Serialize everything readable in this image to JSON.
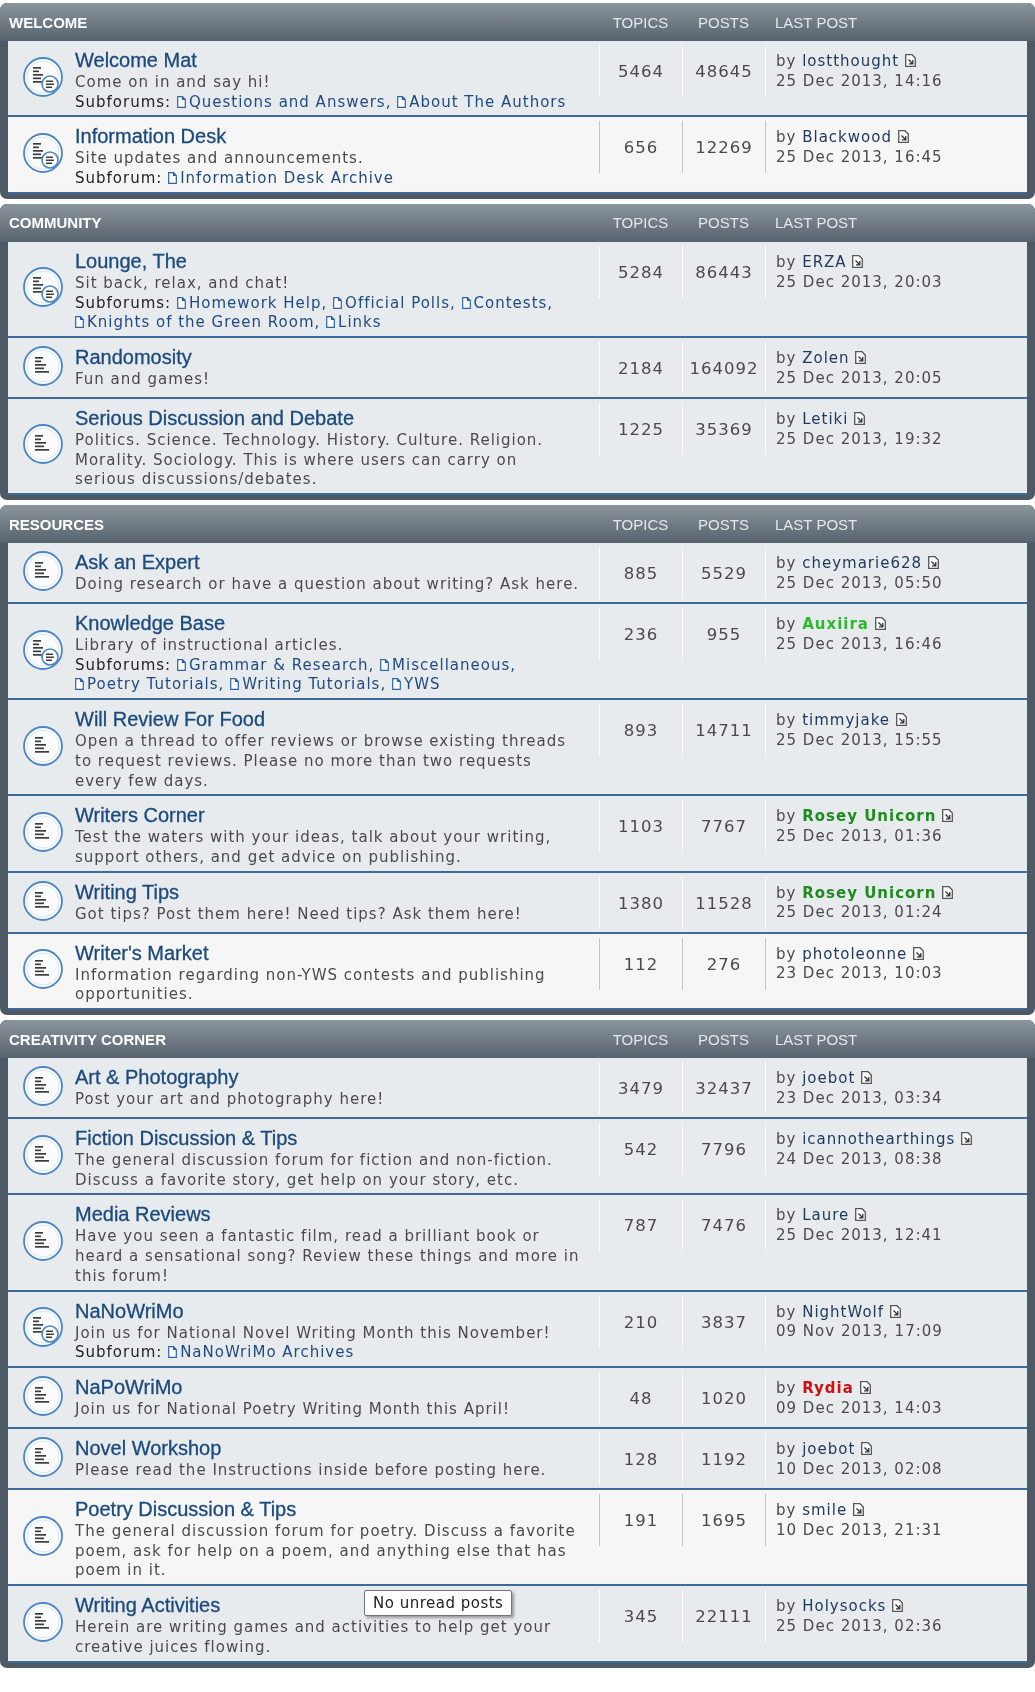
{
  "categories": [
    {
      "title": "WELCOME",
      "columns": [
        "TOPICS",
        "POSTS",
        "LAST POST"
      ],
      "forums": [
        {
          "title": "Welcome Mat",
          "description": "Come on in and say hi!",
          "subforums": {
            "label": "Subforums:",
            "items": [
              "Questions and Answers,",
              "About The Authors"
            ]
          },
          "topics": "5464",
          "posts": "48645",
          "last_post": {
            "by": "by",
            "author": {
              "name": "lostthought",
              "color": "#213a5c",
              "bold": false
            },
            "date": "25 Dec 2013, 14:16"
          },
          "highlighted": false
        },
        {
          "title": "Information Desk",
          "description": "Site updates and announcements.",
          "subforums": {
            "label": "Subforum:",
            "items": [
              "Information Desk Archive"
            ]
          },
          "topics": "656",
          "posts": "12269",
          "last_post": {
            "by": "by",
            "author": {
              "name": "Blackwood",
              "color": "#213a5c",
              "bold": false
            },
            "date": "25 Dec 2013, 16:45"
          },
          "highlighted": true
        }
      ]
    },
    {
      "title": "COMMUNITY",
      "columns": [
        "TOPICS",
        "POSTS",
        "LAST POST"
      ],
      "forums": [
        {
          "title": "Lounge, The",
          "description": "Sit back, relax, and chat!",
          "subforums": {
            "label": "Subforums:",
            "items": [
              "Homework Help,",
              "Official Polls,",
              "Contests,",
              "Knights of the Green Room,",
              "Links"
            ]
          },
          "topics": "5284",
          "posts": "86443",
          "last_post": {
            "by": "by",
            "author": {
              "name": "ERZA",
              "color": "#213a5c",
              "bold": false
            },
            "date": "25 Dec 2013, 20:03"
          },
          "highlighted": false
        },
        {
          "title": "Randomosity",
          "description": "Fun and games!",
          "topics": "2184",
          "posts": "164092",
          "last_post": {
            "by": "by",
            "author": {
              "name": "Zolen",
              "color": "#213a5c",
              "bold": false
            },
            "date": "25 Dec 2013, 20:05"
          },
          "highlighted": false
        },
        {
          "title": "Serious Discussion and Debate",
          "description": "Politics. Science. Technology. History. Culture. Religion. Morality. Sociology. This is where users can carry on serious discussions/debates.",
          "topics": "1225",
          "posts": "35369",
          "last_post": {
            "by": "by",
            "author": {
              "name": "Letiki",
              "color": "#213a5c",
              "bold": false
            },
            "date": "25 Dec 2013, 19:32"
          },
          "highlighted": false
        }
      ]
    },
    {
      "title": "RESOURCES",
      "columns": [
        "TOPICS",
        "POSTS",
        "LAST POST"
      ],
      "forums": [
        {
          "title": "Ask an Expert",
          "description": "Doing research or have a question about writing? Ask here.",
          "topics": "885",
          "posts": "5529",
          "last_post": {
            "by": "by",
            "author": {
              "name": "cheymarie628",
              "color": "#213a5c",
              "bold": false
            },
            "date": "25 Dec 2013, 05:50"
          },
          "highlighted": false
        },
        {
          "title": "Knowledge Base",
          "description": "Library of instructional articles.",
          "subforums": {
            "label": "Subforums:",
            "items": [
              "Grammar & Research,",
              "Miscellaneous,",
              "Poetry Tutorials,",
              "Writing Tutorials,",
              "YWS"
            ]
          },
          "topics": "236",
          "posts": "955",
          "last_post": {
            "by": "by",
            "author": {
              "name": "Auxiira",
              "color": "#2db82d",
              "bold": true
            },
            "date": "25 Dec 2013, 16:46"
          },
          "highlighted": false
        },
        {
          "title": "Will Review For Food",
          "description": "Open a thread to offer reviews or browse existing threads to request reviews. Please no more than two requests every few days.",
          "topics": "893",
          "posts": "14711",
          "last_post": {
            "by": "by",
            "author": {
              "name": "timmyjake",
              "color": "#213a5c",
              "bold": false
            },
            "date": "25 Dec 2013, 15:55"
          },
          "highlighted": false
        },
        {
          "title": "Writers Corner",
          "description": "Test the waters with your ideas, talk about your writing, support others, and get advice on publishing.",
          "topics": "1103",
          "posts": "7767",
          "last_post": {
            "by": "by",
            "author": {
              "name": "Rosey Unicorn",
              "color": "#1e8c1e",
              "bold": true
            },
            "date": "25 Dec 2013, 01:36"
          },
          "highlighted": false
        },
        {
          "title": "Writing Tips",
          "description": "Got tips? Post them here! Need tips? Ask them here!",
          "topics": "1380",
          "posts": "11528",
          "last_post": {
            "by": "by",
            "author": {
              "name": "Rosey Unicorn",
              "color": "#1e8c1e",
              "bold": true
            },
            "date": "25 Dec 2013, 01:24"
          },
          "highlighted": false
        },
        {
          "title": "Writer's Market",
          "description": "Information regarding non-YWS contests and publishing opportunities.",
          "topics": "112",
          "posts": "276",
          "last_post": {
            "by": "by",
            "author": {
              "name": "photoleonne",
              "color": "#213a5c",
              "bold": false
            },
            "date": "23 Dec 2013, 10:03"
          },
          "highlighted": true
        }
      ]
    },
    {
      "title": "CREATIVITY CORNER",
      "columns": [
        "TOPICS",
        "POSTS",
        "LAST POST"
      ],
      "forums": [
        {
          "title": "Art & Photography",
          "description": "Post your art and photography here!",
          "topics": "3479",
          "posts": "32437",
          "last_post": {
            "by": "by",
            "author": {
              "name": "joebot",
              "color": "#213a5c",
              "bold": false
            },
            "date": "23 Dec 2013, 03:34"
          },
          "highlighted": false
        },
        {
          "title": "Fiction Discussion & Tips",
          "description": "The general discussion forum for fiction and non-fiction. Discuss a favorite story, get help on your story, etc.",
          "topics": "542",
          "posts": "7796",
          "last_post": {
            "by": "by",
            "author": {
              "name": "icannothearthings",
              "color": "#213a5c",
              "bold": false
            },
            "date": "24 Dec 2013, 08:38"
          },
          "highlighted": false
        },
        {
          "title": "Media Reviews",
          "description": "Have you seen a fantastic film, read a brilliant book or heard a sensational song? Review these things and more in this forum!",
          "topics": "787",
          "posts": "7476",
          "last_post": {
            "by": "by",
            "author": {
              "name": "Laure",
              "color": "#213a5c",
              "bold": false
            },
            "date": "25 Dec 2013, 12:41"
          },
          "highlighted": false
        },
        {
          "title": "NaNoWriMo",
          "description": "Join us for National Novel Writing Month this November!",
          "subforums": {
            "label": "Subforum:",
            "items": [
              "NaNoWriMo Archives"
            ]
          },
          "topics": "210",
          "posts": "3837",
          "last_post": {
            "by": "by",
            "author": {
              "name": "NightWolf",
              "color": "#213a5c",
              "bold": false
            },
            "date": "09 Nov 2013, 17:09"
          },
          "highlighted": false
        },
        {
          "title": "NaPoWriMo",
          "description": "Join us for National Poetry Writing Month this April!",
          "topics": "48",
          "posts": "1020",
          "last_post": {
            "by": "by",
            "author": {
              "name": "Rydia",
              "color": "#cc1111",
              "bold": true
            },
            "date": "09 Dec 2013, 14:03"
          },
          "highlighted": false
        },
        {
          "title": "Novel Workshop",
          "description": "Please read the Instructions inside before posting here.",
          "topics": "128",
          "posts": "1192",
          "last_post": {
            "by": "by",
            "author": {
              "name": "joebot",
              "color": "#213a5c",
              "bold": false
            },
            "date": "10 Dec 2013, 02:08"
          },
          "highlighted": false
        },
        {
          "title": "Poetry Discussion & Tips",
          "description": "The general discussion forum for poetry. Discuss a favorite poem, ask for help on a poem, and anything else that has poem in it.",
          "topics": "191",
          "posts": "1695",
          "last_post": {
            "by": "by",
            "author": {
              "name": "smile",
              "color": "#213a5c",
              "bold": false
            },
            "date": "10 Dec 2013, 21:31"
          },
          "highlighted": true
        },
        {
          "title": "Writing Activities",
          "description": "Herein are writing games and activities to help get your creative juices flowing.",
          "topics": "345",
          "posts": "22111",
          "last_post": {
            "by": "by",
            "author": {
              "name": "Holysocks",
              "color": "#213a5c",
              "bold": false
            },
            "date": "25 Dec 2013, 02:36"
          },
          "highlighted": false,
          "tooltip": "No unread posts"
        }
      ]
    }
  ]
}
